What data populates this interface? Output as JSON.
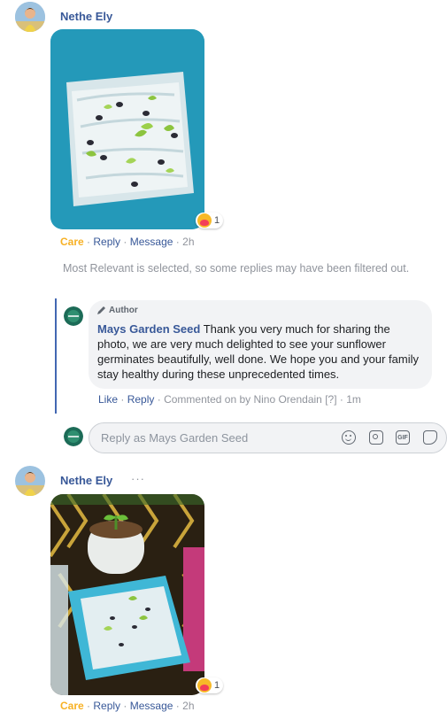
{
  "comment1": {
    "author": "Nethe Ely",
    "reaction_count": "1",
    "actions": {
      "care": "Care",
      "reply": "Reply",
      "message": "Message",
      "time": "2h"
    }
  },
  "filter_notice": "Most Relevant is selected, so some replies may have been filtered out.",
  "reply": {
    "badge": "Author",
    "author": "Mays Garden Seed",
    "text": "Thank you very much for sharing the photo, we are very much delighted to see your sunflower germinates beautifully, well done. We hope you and your family stay healthy during these unprecedented times.",
    "actions": {
      "like": "Like",
      "reply": "Reply",
      "commented_on_by": "Commented on by Nino Orendain",
      "help_mark": "[?]",
      "time": "1m"
    }
  },
  "composer": {
    "placeholder": "Reply as Mays Garden Seed",
    "icons": [
      "emoji-icon",
      "camera-icon",
      "gif-icon",
      "sticker-icon"
    ],
    "gif_label": "GIF"
  },
  "comment2": {
    "author": "Nethe Ely",
    "more": "···",
    "reaction_count": "1",
    "actions": {
      "care": "Care",
      "reply": "Reply",
      "message": "Message",
      "time": "2h"
    }
  },
  "colors": {
    "link": "#385898",
    "care": "#f7b125",
    "meta": "#90949c",
    "thread_line": "#4267b2",
    "bubble": "#f2f3f5"
  }
}
